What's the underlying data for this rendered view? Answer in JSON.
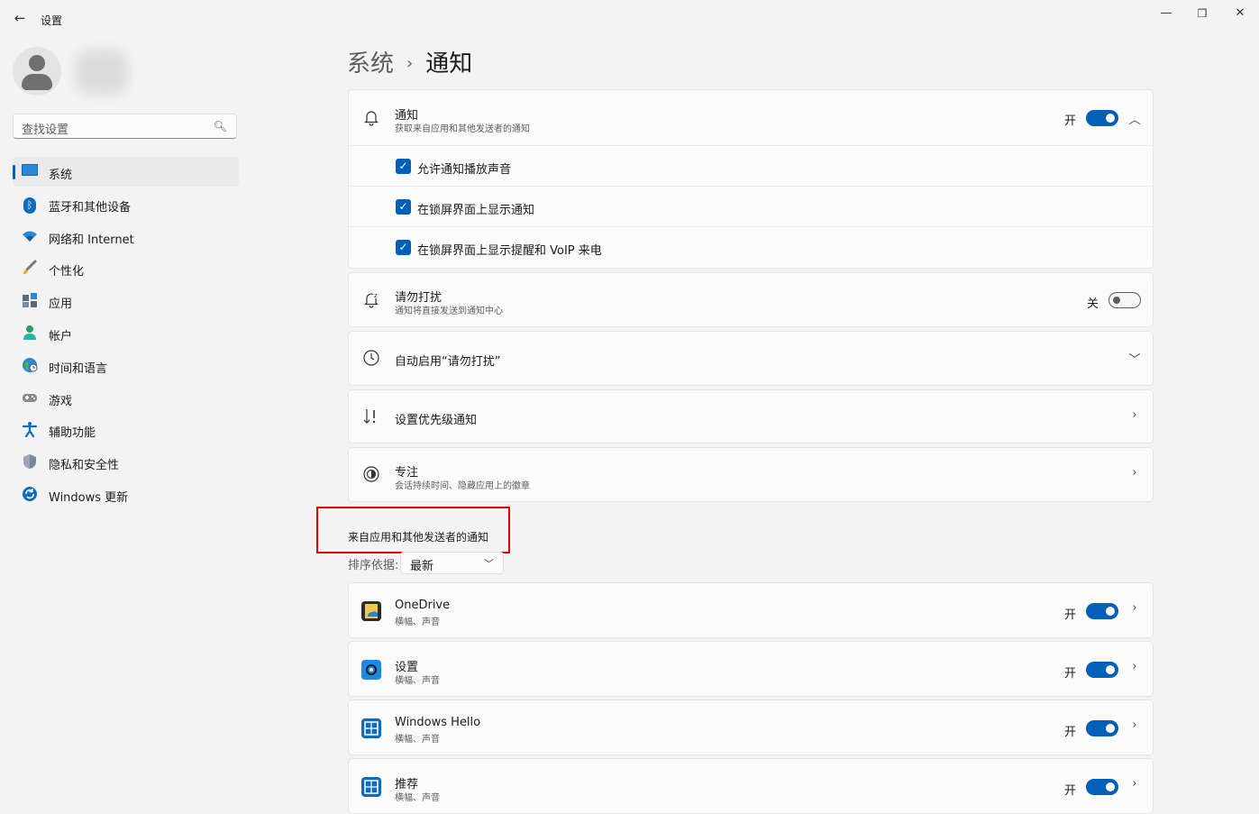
{
  "window": {
    "title": "设置",
    "controls": {
      "minimize": "—",
      "restore": "❐",
      "close": "✕"
    }
  },
  "search": {
    "placeholder": "查找设置"
  },
  "sidebar": {
    "items": [
      {
        "label": "系统",
        "icon": "system-icon"
      },
      {
        "label": "蓝牙和其他设备",
        "icon": "bluetooth-icon"
      },
      {
        "label": "网络和 Internet",
        "icon": "wifi-icon"
      },
      {
        "label": "个性化",
        "icon": "brush-icon"
      },
      {
        "label": "应用",
        "icon": "apps-icon"
      },
      {
        "label": "帐户",
        "icon": "account-icon"
      },
      {
        "label": "时间和语言",
        "icon": "globe-clock-icon"
      },
      {
        "label": "游戏",
        "icon": "gamepad-icon"
      },
      {
        "label": "辅助功能",
        "icon": "accessibility-icon"
      },
      {
        "label": "隐私和安全性",
        "icon": "shield-icon"
      },
      {
        "label": "Windows 更新",
        "icon": "update-icon"
      }
    ],
    "active_index": 0
  },
  "breadcrumb": {
    "parent": "系统",
    "separator": "›",
    "current": "通知"
  },
  "notifications": {
    "title": "通知",
    "subtitle": "获取来自应用和其他发送者的通知",
    "state": "开",
    "on": true,
    "options": [
      {
        "label": "允许通知播放声音",
        "checked": true
      },
      {
        "label": "在锁屏界面上显示通知",
        "checked": true
      },
      {
        "label": "在锁屏界面上显示提醒和 VoIP 来电",
        "checked": true
      }
    ]
  },
  "dnd": {
    "title": "请勿打扰",
    "subtitle": "通知将直接发送到通知中心",
    "state": "关",
    "on": false
  },
  "auto_dnd": {
    "title": "自动启用“请勿打扰”"
  },
  "priority": {
    "title": "设置优先级通知"
  },
  "focus": {
    "title": "专注",
    "subtitle": "会话持续时间、隐藏应用上的徽章"
  },
  "apps_section": {
    "title": "来自应用和其他发送者的通知",
    "sort_label": "排序依据:",
    "sort_value": "最新"
  },
  "apps": [
    {
      "name": "OneDrive",
      "detail": "横幅、声音",
      "state": "开",
      "on": true
    },
    {
      "name": "设置",
      "detail": "横幅、声音",
      "state": "开",
      "on": true
    },
    {
      "name": "Windows Hello",
      "detail": "横幅、声音",
      "state": "开",
      "on": true
    },
    {
      "name": "推荐",
      "detail": "横幅、声音",
      "state": "开",
      "on": true
    }
  ],
  "colors": {
    "accent": "#005fb8",
    "highlight_box": "#e00000",
    "background": "#f3f3f3"
  }
}
